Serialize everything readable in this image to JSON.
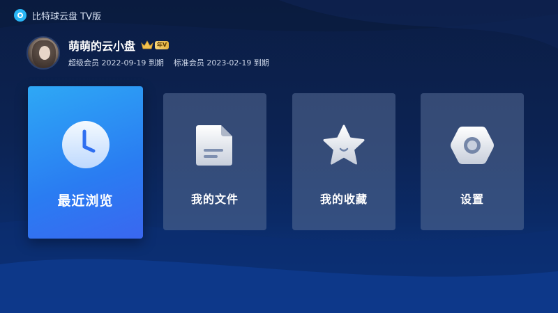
{
  "app": {
    "title": "比特球云盘 TV版"
  },
  "profile": {
    "name": "萌萌的云小盘",
    "badge": "年V",
    "memberships": [
      {
        "label": "超级会员 2022-09-19 到期"
      },
      {
        "label": "标准会员 2023-02-19 到期"
      }
    ]
  },
  "menu": {
    "items": [
      {
        "label": "最近浏览",
        "icon": "clock-icon"
      },
      {
        "label": "我的文件",
        "icon": "document-icon"
      },
      {
        "label": "我的收藏",
        "icon": "star-icon"
      },
      {
        "label": "设置",
        "icon": "gear-icon"
      }
    ]
  },
  "colors": {
    "background_top": "#0b1d44",
    "background_bottom": "#0d3a8a",
    "active_card": "#2a7cf2",
    "card": "#3b4e70",
    "badge_gold": "#e5b33f"
  }
}
